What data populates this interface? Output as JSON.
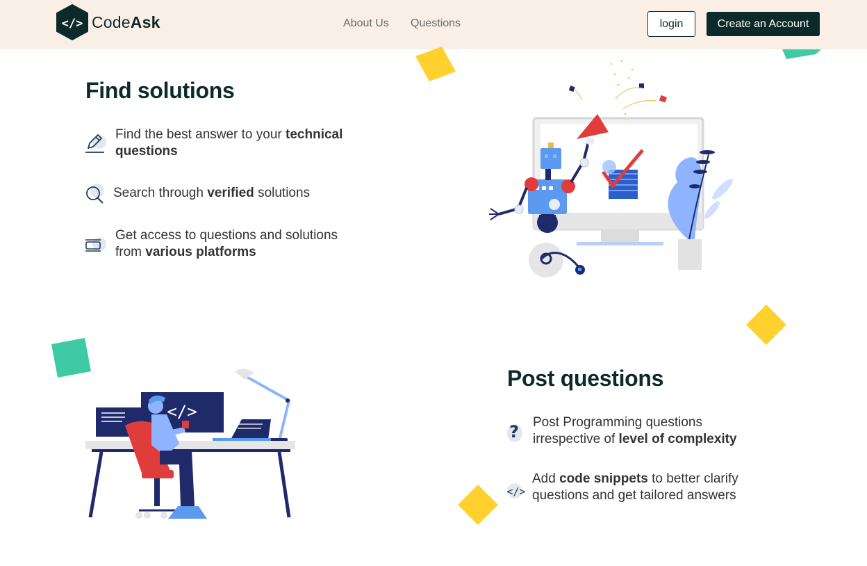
{
  "brand": {
    "logo_symbol": "</>",
    "name_regular": "Code",
    "name_bold": "Ask",
    "color_dark": "#0d2a2a",
    "header_bg": "#faefe6"
  },
  "nav": {
    "about": "About Us",
    "questions": "Questions",
    "login": "login",
    "create": "Create an Account"
  },
  "find": {
    "title": "Find solutions",
    "items": [
      {
        "icon": "pencil-icon",
        "text": "Find the best answer to your ",
        "bold": "technical",
        "line2": "questions"
      },
      {
        "icon": "search-icon",
        "text": "Search through ",
        "bold": "verified",
        "after": " solutions"
      },
      {
        "icon": "platforms-icon",
        "text": "Get access to questions and solutions",
        "line2_prefix": "from ",
        "bold": "various platforms"
      }
    ]
  },
  "post": {
    "title": "Post questions",
    "items": [
      {
        "icon": "question-icon",
        "symbol": "?",
        "text": "Post Programming questions",
        "line2_prefix": "irrespective of ",
        "bold": "level of complexity"
      },
      {
        "icon": "code-icon",
        "symbol": "</>",
        "prefix": "Add ",
        "bold": "code snippets",
        "after": " to better clarify",
        "line2": "questions and get tailored answers"
      }
    ]
  },
  "illustrations": {
    "robot_monitor_symbol": "</>",
    "desk_monitor_symbol": "</>"
  },
  "colors": {
    "yellow": "#ffd12e",
    "teal": "#3fcaa6",
    "navy": "#1f2a6b",
    "red": "#e03c3c",
    "blue": "#5b9af0"
  }
}
